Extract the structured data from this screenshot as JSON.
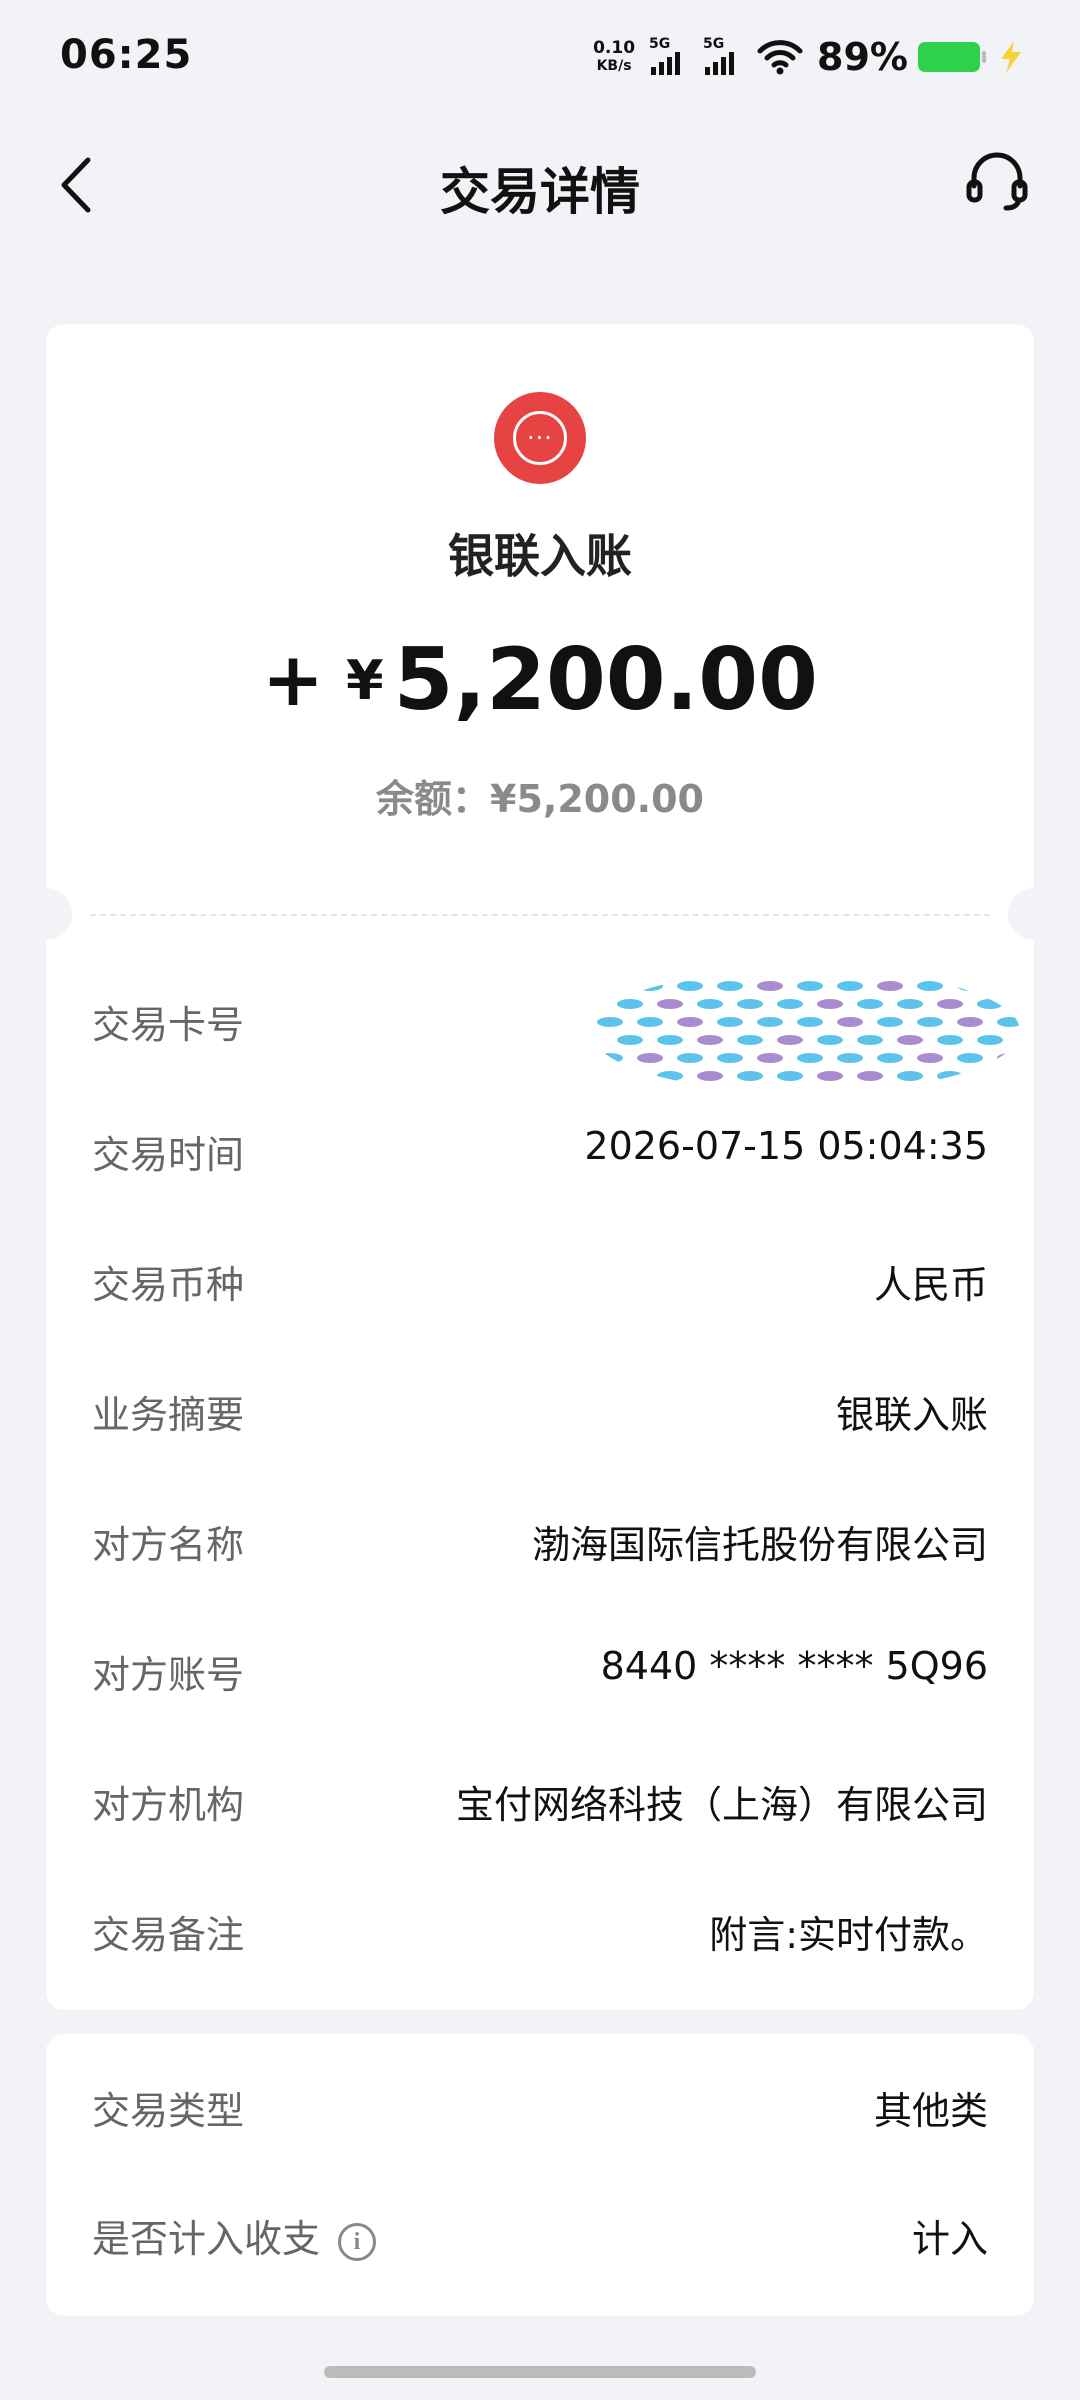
{
  "status_bar": {
    "time": "06:25",
    "net_speed_value": "0.10",
    "net_speed_unit": "KB/s",
    "signal1_label": "5G",
    "signal2_label": "5G",
    "battery_percent": "89%",
    "battery_color": "#2fd14a",
    "icons": [
      "wifi-icon",
      "charging-bolt-icon"
    ]
  },
  "header": {
    "title": "交易详情",
    "back_icon": "chevron-left-icon",
    "service_icon": "headset-icon"
  },
  "transaction": {
    "icon": "more-dots-icon",
    "icon_color": "#e74343",
    "type": "银联入账",
    "amount_sign": "+",
    "currency_symbol": "¥",
    "amount": "5,200.00",
    "balance_text": "余额：¥5,200.00"
  },
  "details": [
    {
      "label": "交易卡号",
      "value": ""
    },
    {
      "label": "交易时间",
      "value": "2026-07-15 05:04:35"
    },
    {
      "label": "交易币种",
      "value": "人民币"
    },
    {
      "label": "业务摘要",
      "value": "银联入账"
    },
    {
      "label": "对方名称",
      "value": "渤海国际信托股份有限公司"
    },
    {
      "label": "对方账号",
      "value": "8440 **** **** 5Q96"
    },
    {
      "label": "对方机构",
      "value": "宝付网络科技（上海）有限公司"
    },
    {
      "label": "交易备注",
      "value": "附言:实时付款。"
    }
  ],
  "extra": [
    {
      "label": "交易类型",
      "value": "其他类"
    },
    {
      "label": "是否计入收支",
      "value": "计入",
      "info_icon": "i"
    }
  ]
}
